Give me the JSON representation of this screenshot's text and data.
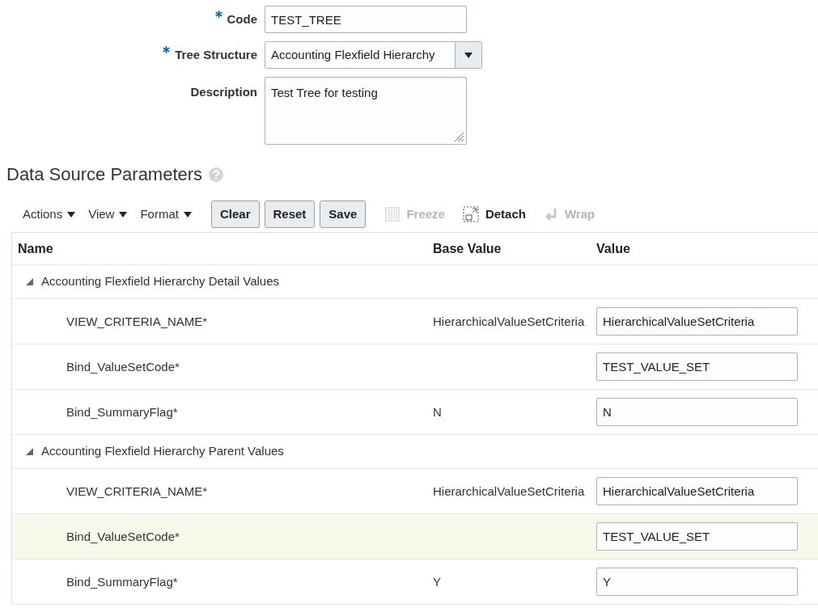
{
  "form": {
    "fields": [
      {
        "kind": "text",
        "label": "Code",
        "required": true,
        "value": "TEST_TREE"
      },
      {
        "kind": "select",
        "label": "Tree Structure",
        "required": true,
        "value": "Accounting Flexfield Hierarchy"
      },
      {
        "kind": "textarea",
        "label": "Description",
        "required": false,
        "value": "Test Tree for testing"
      }
    ]
  },
  "section": {
    "title": "Data Source Parameters"
  },
  "toolbar": {
    "menus": [
      "Actions",
      "View",
      "Format"
    ],
    "buttons": [
      "Clear",
      "Reset",
      "Save"
    ],
    "tools": [
      {
        "kind": "freeze",
        "label": "Freeze",
        "disabled": true
      },
      {
        "kind": "detach",
        "label": "Detach",
        "disabled": false
      },
      {
        "kind": "wrap",
        "label": "Wrap",
        "disabled": true
      }
    ]
  },
  "table": {
    "columns": [
      "Name",
      "Base Value",
      "Value"
    ],
    "groups": [
      {
        "name": "Accounting Flexfield Hierarchy Detail Values",
        "expanded": true,
        "children": [
          {
            "name": "VIEW_CRITERIA_NAME*",
            "base_value": "HierarchicalValueSetCriteria",
            "value": "HierarchicalValueSetCriteria",
            "selected": false
          },
          {
            "name": "Bind_ValueSetCode*",
            "value": "TEST_VALUE_SET",
            "selected": false
          },
          {
            "name": "Bind_SummaryFlag*",
            "base_value": "N",
            "value": "N",
            "selected": false
          }
        ]
      },
      {
        "name": "Accounting Flexfield Hierarchy Parent Values",
        "expanded": true,
        "children": [
          {
            "name": "VIEW_CRITERIA_NAME*",
            "base_value": "HierarchicalValueSetCriteria",
            "value": "HierarchicalValueSetCriteria",
            "selected": false
          },
          {
            "name": "Bind_ValueSetCode*",
            "value": "TEST_VALUE_SET",
            "selected": true
          },
          {
            "name": "Bind_SummaryFlag*",
            "base_value": "Y",
            "value": "Y",
            "selected": false
          }
        ]
      }
    ]
  }
}
